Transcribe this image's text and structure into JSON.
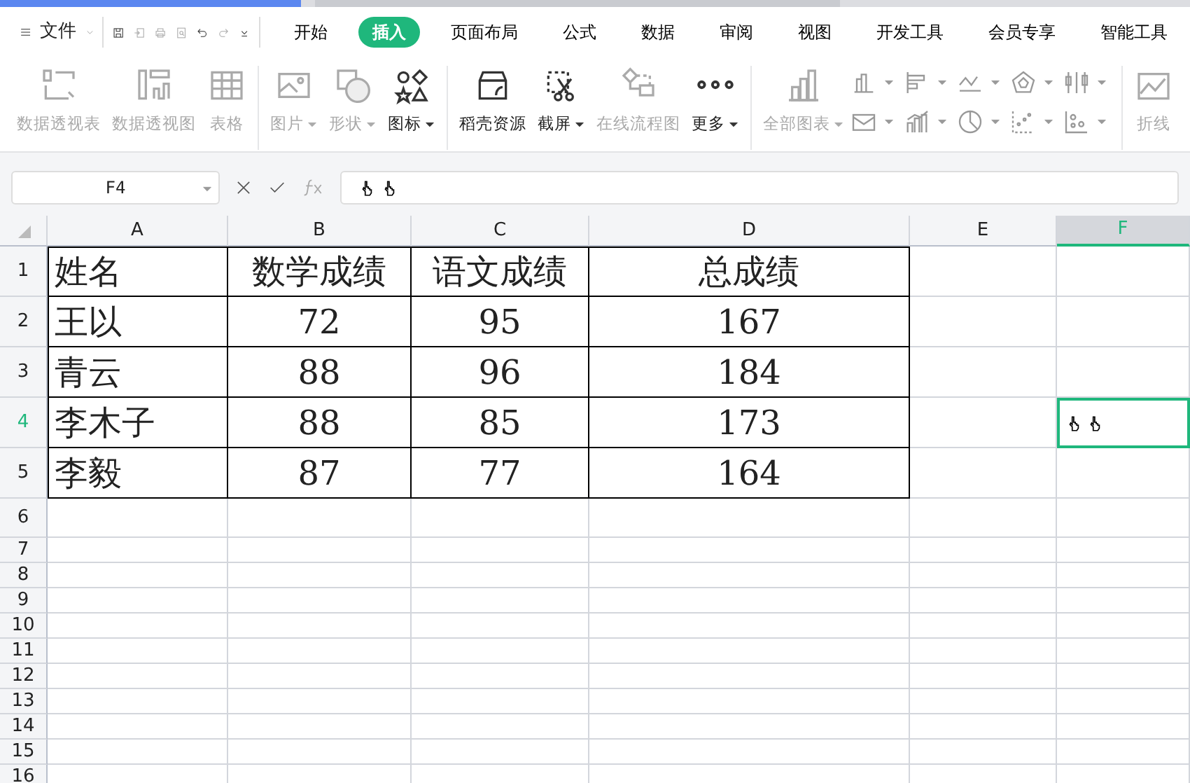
{
  "menu": {
    "label": "文件"
  },
  "ribbon_tabs": [
    {
      "label": "开始",
      "selected": false
    },
    {
      "label": "插入",
      "selected": true
    },
    {
      "label": "页面布局",
      "selected": false
    },
    {
      "label": "公式",
      "selected": false
    },
    {
      "label": "数据",
      "selected": false
    },
    {
      "label": "审阅",
      "selected": false
    },
    {
      "label": "视图",
      "selected": false
    },
    {
      "label": "开发工具",
      "selected": false
    },
    {
      "label": "会员专享",
      "selected": false
    },
    {
      "label": "智能工具",
      "selected": false
    }
  ],
  "toolbar": [
    {
      "label": "数据透视表",
      "dropdown": false,
      "disabled": true
    },
    {
      "label": "数据透视图",
      "dropdown": false,
      "disabled": true
    },
    {
      "label": "表格",
      "dropdown": false,
      "disabled": true
    },
    {
      "label": "图片",
      "dropdown": true,
      "disabled": true
    },
    {
      "label": "形状",
      "dropdown": true,
      "disabled": true
    },
    {
      "label": "图标",
      "dropdown": true,
      "disabled": false
    },
    {
      "label": "稻壳资源",
      "dropdown": false,
      "disabled": false
    },
    {
      "label": "截屏",
      "dropdown": true,
      "disabled": false
    },
    {
      "label": "在线流程图",
      "dropdown": false,
      "disabled": true
    },
    {
      "label": "更多",
      "dropdown": true,
      "disabled": false
    },
    {
      "label": "全部图表",
      "dropdown": true,
      "disabled": true
    },
    {
      "label": "折线",
      "dropdown": false,
      "disabled": true
    }
  ],
  "formula_bar": {
    "name_box": "F4"
  },
  "sheet": {
    "columns": [
      {
        "label": "A",
        "selected": false
      },
      {
        "label": "B",
        "selected": false
      },
      {
        "label": "C",
        "selected": false
      },
      {
        "label": "D",
        "selected": false
      },
      {
        "label": "E",
        "selected": false
      },
      {
        "label": "F",
        "selected": true
      }
    ],
    "row_headers": [
      {
        "label": "1",
        "selected": false
      },
      {
        "label": "2",
        "selected": false
      },
      {
        "label": "3",
        "selected": false
      },
      {
        "label": "4",
        "selected": true
      },
      {
        "label": "5",
        "selected": false
      },
      {
        "label": "6",
        "selected": false
      },
      {
        "label": "7",
        "selected": false
      },
      {
        "label": "8",
        "selected": false
      },
      {
        "label": "9",
        "selected": false
      },
      {
        "label": "10",
        "selected": false
      },
      {
        "label": "11",
        "selected": false
      },
      {
        "label": "12",
        "selected": false
      },
      {
        "label": "13",
        "selected": false
      },
      {
        "label": "14",
        "selected": false
      },
      {
        "label": "15",
        "selected": false
      },
      {
        "label": "16",
        "selected": false
      }
    ],
    "rows": [
      [
        "姓名",
        "数学成绩",
        "语文成绩",
        "总成绩"
      ],
      [
        "王以",
        "72",
        "95",
        "167"
      ],
      [
        "青云",
        "88",
        "96",
        "184"
      ],
      [
        "李木子",
        "88",
        "85",
        "173"
      ],
      [
        "李毅",
        "87",
        "77",
        "164"
      ]
    ]
  }
}
